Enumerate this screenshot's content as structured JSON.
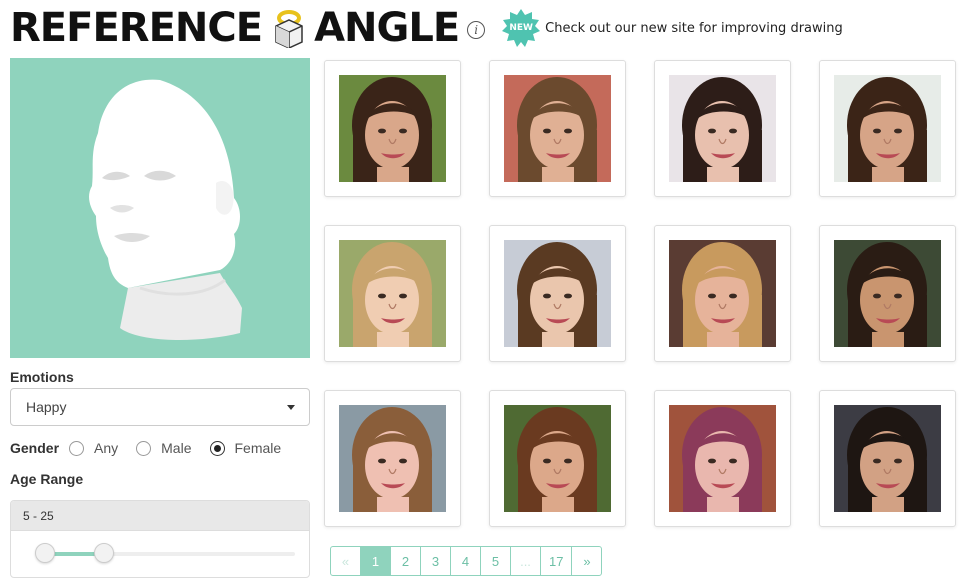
{
  "header": {
    "logo_left": "REFERENCE",
    "logo_right": "ANGLE",
    "info_glyph": "i",
    "badge": "NEW",
    "news_text": "Check out our new site for improving drawing",
    "colors": {
      "accent": "#8fd3bd",
      "badge": "#4fc3b0",
      "logo_ring": "#e8c21c"
    }
  },
  "sidebar": {
    "emotions_label": "Emotions",
    "emotion_value": "Happy",
    "gender_label": "Gender",
    "gender_options": [
      "Any",
      "Male",
      "Female"
    ],
    "gender_selected": "Female",
    "age_label": "Age Range",
    "age_value": "5 - 25",
    "age_slider": {
      "min_fraction": 0.0,
      "max_fraction": 0.23
    }
  },
  "gallery": {
    "photos": [
      {
        "hair": "#3a2418",
        "skin": "#d9a78a",
        "bg": "#6b8a3f"
      },
      {
        "hair": "#6b4a2e",
        "skin": "#e0b094",
        "bg": "#c46a5a"
      },
      {
        "hair": "#2d1d18",
        "skin": "#e8c0ae",
        "bg": "#e9e4e8"
      },
      {
        "hair": "#3b2417",
        "skin": "#d6a487",
        "bg": "#e7ece8"
      },
      {
        "hair": "#c9a46e",
        "skin": "#f0cdb2",
        "bg": "#9aa96a"
      },
      {
        "hair": "#5a3a22",
        "skin": "#eac6ad",
        "bg": "#c7ccd6"
      },
      {
        "hair": "#c89a5e",
        "skin": "#e6b39a",
        "bg": "#5a3c33"
      },
      {
        "hair": "#2a1c14",
        "skin": "#c9956f",
        "bg": "#3d4a35"
      },
      {
        "hair": "#8a5e3a",
        "skin": "#efc0b2",
        "bg": "#8a9aa4"
      },
      {
        "hair": "#6a3a20",
        "skin": "#dca88a",
        "bg": "#4f6a33"
      },
      {
        "hair": "#8b3a5a",
        "skin": "#e9b7ae",
        "bg": "#a0533c"
      },
      {
        "hair": "#1e1612",
        "skin": "#d2a184",
        "bg": "#3c3c44"
      }
    ]
  },
  "pagination": {
    "prev": "«",
    "pages": [
      "1",
      "2",
      "3",
      "4",
      "5"
    ],
    "ellipsis": "...",
    "last": "17",
    "next": "»",
    "current": "1"
  }
}
